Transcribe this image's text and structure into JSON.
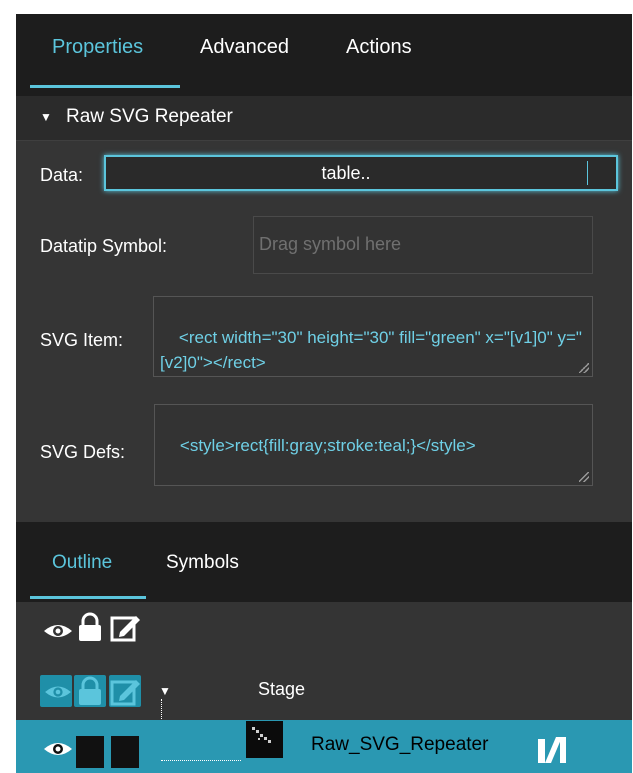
{
  "tabs": [
    "Properties",
    "Advanced",
    "Actions"
  ],
  "active_tab": "Properties",
  "section": {
    "title": "Raw SVG Repeater"
  },
  "properties": {
    "data_label": "Data:",
    "data_value": "table..",
    "datatip_label": "Datatip Symbol:",
    "datatip_placeholder": "Drag symbol here",
    "svg_item_label": "SVG Item:",
    "svg_item_value": "<rect width=\"30\" height=\"30\" fill=\"green\" x=\"[v1]0\" y=\"[v2]0\"></rect>",
    "svg_defs_label": "SVG Defs:",
    "svg_defs_value": "<style>rect{fill:gray;stroke:teal;}</style>"
  },
  "outline_tabs": [
    "Outline",
    "Symbols"
  ],
  "active_outline_tab": "Outline",
  "tree": {
    "stage_label": "Stage",
    "repeater_label": "Raw_SVG_Repeater"
  },
  "colors": {
    "accent": "#5bc5dc",
    "selected_row": "#2a98b2",
    "panel_bg": "#353535",
    "tab_bar_bg": "#1d1d1d"
  },
  "icons": [
    "eye-icon",
    "lock-icon",
    "edit-icon",
    "expand-triangle-icon",
    "symbol-thumbnail-icon",
    "component-type-icon"
  ]
}
